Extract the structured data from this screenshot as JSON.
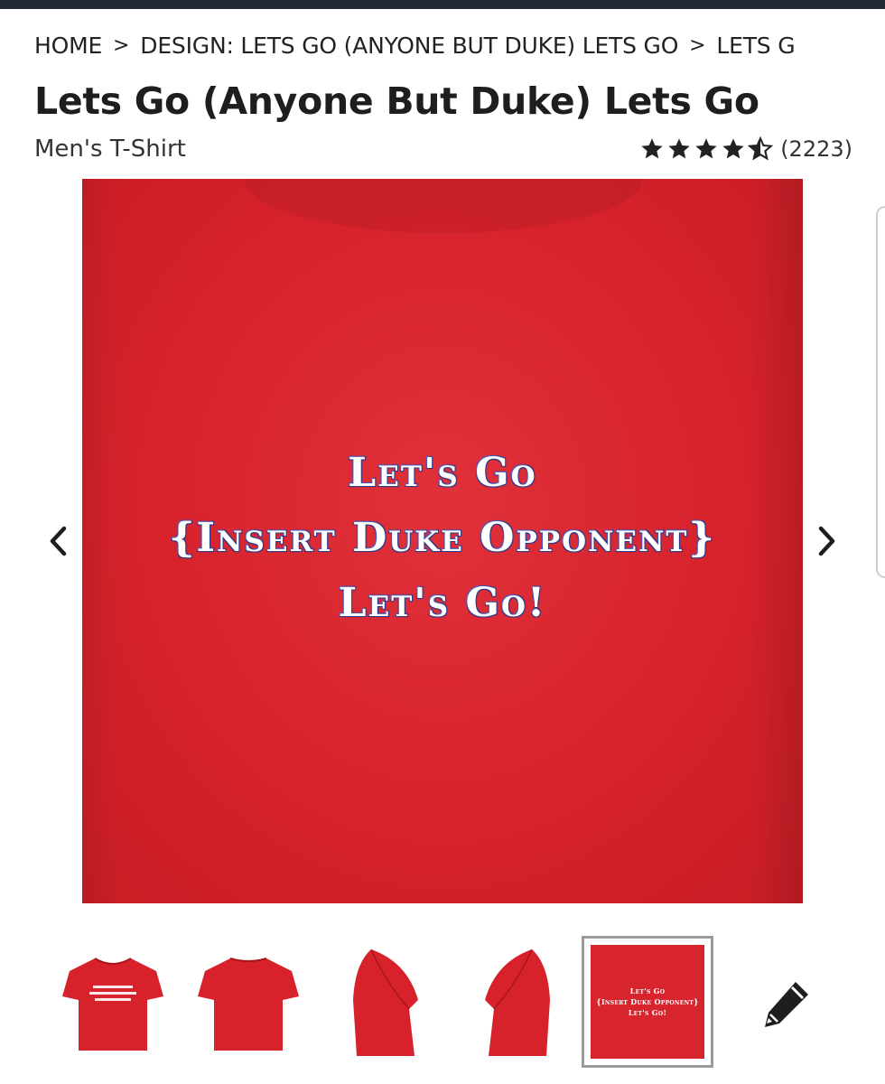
{
  "breadcrumb": {
    "items": [
      "HOME",
      "DESIGN: LETS GO (ANYONE BUT DUKE) LETS GO",
      "LETS G"
    ],
    "separator": ">"
  },
  "product": {
    "title": "Lets Go (Anyone But Duke) Lets Go",
    "type": "Men's T-Shirt",
    "rating": 4.5,
    "review_count": "(2223)"
  },
  "main_image": {
    "shirt_color": "#d7222c",
    "print_lines": [
      "Let's Go",
      "{Insert Duke Opponent}",
      "Let's Go!"
    ]
  },
  "gallery": {
    "prev_icon": "chevron-left-icon",
    "next_icon": "chevron-right-icon",
    "thumbnails": [
      {
        "view": "front",
        "active": false
      },
      {
        "view": "back",
        "active": false
      },
      {
        "view": "left-sleeve",
        "active": false
      },
      {
        "view": "right-sleeve",
        "active": false
      },
      {
        "view": "design-closeup",
        "active": true
      }
    ],
    "closeup_lines": [
      "Let's Go",
      "{Insert Duke Opponent}",
      "Let's Go!"
    ],
    "edit_icon": "pencil-icon"
  },
  "colors": {
    "topbar": "#232a35",
    "shirt": "#d7222c",
    "text": "#222222"
  }
}
